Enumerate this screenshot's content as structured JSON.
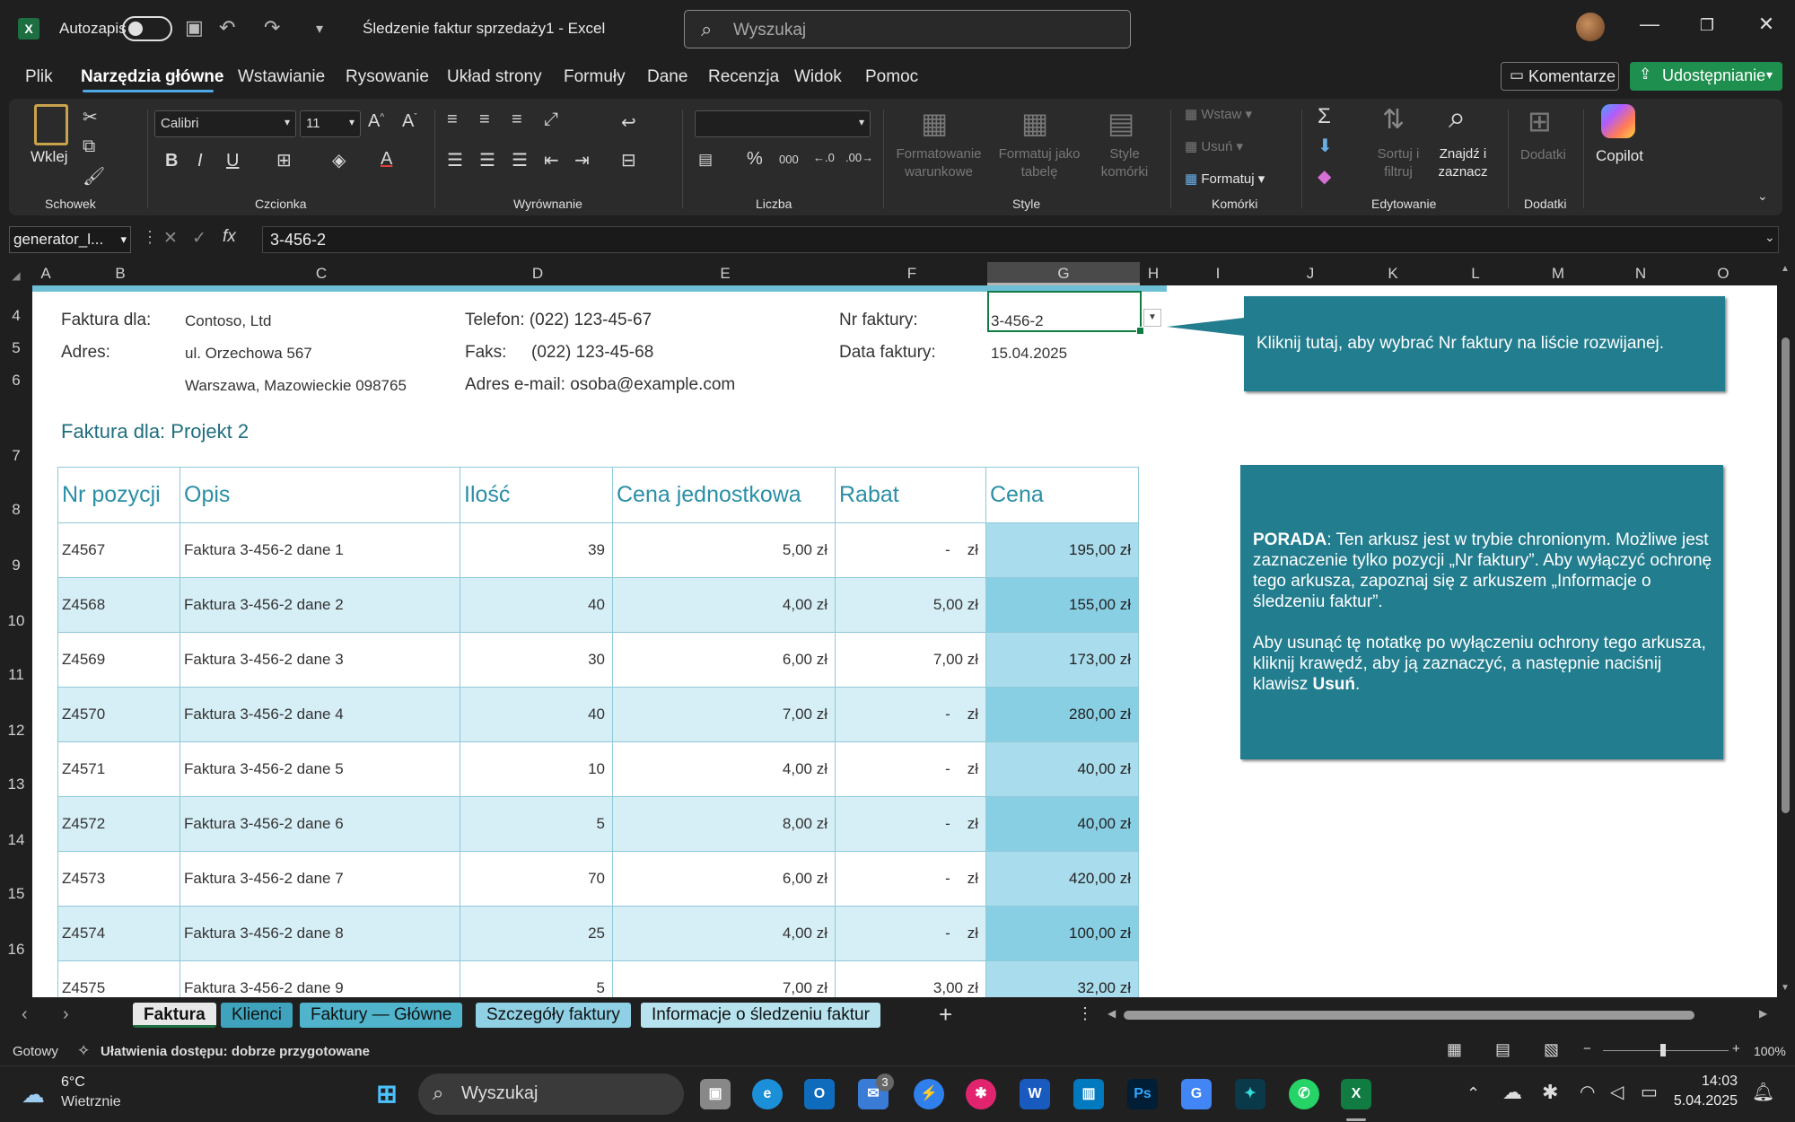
{
  "window": {
    "autosave_label": "Autozapis",
    "title": "Śledzenie faktur sprzedaży1  -  Excel",
    "search_placeholder": "Wyszukaj"
  },
  "menu": {
    "items": [
      "Plik",
      "Narzędzia główne",
      "Wstawianie",
      "Rysowanie",
      "Układ strony",
      "Formuły",
      "Dane",
      "Recenzja",
      "Widok",
      "Pomoc"
    ],
    "comments_label": "Komentarze",
    "share_label": "Udostępnianie"
  },
  "ribbon": {
    "paste": "Wklej",
    "clipboard": "Schowek",
    "font_name": "Calibri",
    "font_size": "11",
    "font_group": "Czcionka",
    "alignment_group": "Wyrównanie",
    "number_group": "Liczba",
    "cond_format": "Formatowanie warunkowe",
    "format_table": "Formatuj jako tabelę",
    "cell_styles": "Style komórki",
    "styles_group": "Style",
    "insert": "Wstaw",
    "delete": "Usuń",
    "format": "Formatuj",
    "cells_group": "Komórki",
    "sort_filter": "Sortuj i filtruj",
    "find_select": "Znajdź i zaznacz",
    "editing_group": "Edytowanie",
    "addins": "Dodatki",
    "addins_group": "Dodatki",
    "copilot": "Copilot"
  },
  "formula_bar": {
    "name_box": "generator_l...",
    "content": "3-456-2"
  },
  "columns": [
    "A",
    "B",
    "C",
    "D",
    "E",
    "F",
    "G",
    "H",
    "I",
    "J",
    "K",
    "L",
    "M",
    "N",
    "O"
  ],
  "selected_column": "G",
  "rows": [
    "4",
    "5",
    "6",
    "7",
    "8",
    "9",
    "10",
    "11",
    "12",
    "13",
    "14",
    "15",
    "16"
  ],
  "header": {
    "bill_to_label": "Faktura dla:",
    "bill_to_value": "Contoso, Ltd",
    "address_label": "Adres:",
    "address_line1": "ul. Orzechowa 567",
    "address_line2": "Warszawa, Mazowieckie 098765",
    "phone": "Telefon: (022) 123-45-67",
    "fax_label": "Faks:",
    "fax_value": "(022) 123-45-68",
    "email": "Adres e-mail: osoba@example.com",
    "invoice_no_label": "Nr faktury:",
    "invoice_no_value": "3-456-2",
    "invoice_date_label": "Data faktury:",
    "invoice_date_value": "15.04.2025",
    "project": "Faktura dla: Projekt 2"
  },
  "callout": "Kliknij tutaj, aby wybrać Nr faktury na liście rozwijanej.",
  "tip": {
    "bold1": "PORADA",
    "text1": ": Ten arkusz jest w trybie chronionym. Możliwe jest zaznaczenie tylko pozycji „Nr faktury”. Aby wyłączyć ochronę tego arkusza, zapoznaj się z arkuszem „Informacje o śledzeniu faktur”.",
    "text2": "Aby usunąć tę notatkę po wyłączeniu ochrony tego arkusza, kliknij krawędź, aby ją zaznaczyć, a następnie naciśnij klawisz ",
    "bold2": "Usuń",
    "end": "."
  },
  "table": {
    "headers": [
      "Nr pozycji",
      "Opis",
      "Ilość",
      "Cena jednostkowa",
      "Rabat",
      "Cena"
    ],
    "rows": [
      [
        "Z4567",
        "Faktura 3-456-2 dane 1",
        "39",
        "5,00 zł",
        "-    zł",
        "195,00 zł"
      ],
      [
        "Z4568",
        "Faktura 3-456-2 dane 2",
        "40",
        "4,00 zł",
        "5,00 zł",
        "155,00 zł"
      ],
      [
        "Z4569",
        "Faktura 3-456-2 dane 3",
        "30",
        "6,00 zł",
        "7,00 zł",
        "173,00 zł"
      ],
      [
        "Z4570",
        "Faktura 3-456-2 dane 4",
        "40",
        "7,00 zł",
        "-    zł",
        "280,00 zł"
      ],
      [
        "Z4571",
        "Faktura 3-456-2 dane 5",
        "10",
        "4,00 zł",
        "-    zł",
        "40,00 zł"
      ],
      [
        "Z4572",
        "Faktura 3-456-2 dane 6",
        "5",
        "8,00 zł",
        "-    zł",
        "40,00 zł"
      ],
      [
        "Z4573",
        "Faktura 3-456-2 dane 7",
        "70",
        "6,00 zł",
        "-    zł",
        "420,00 zł"
      ],
      [
        "Z4574",
        "Faktura 3-456-2 dane 8",
        "25",
        "4,00 zł",
        "-    zł",
        "100,00 zł"
      ],
      [
        "Z4575",
        "Faktura 3-456-2 dane 9",
        "5",
        "7,00 zł",
        "3,00 zł",
        "32,00 zł"
      ]
    ]
  },
  "sheet_tabs": [
    {
      "label": "Faktura",
      "color": "#e8e8e8"
    },
    {
      "label": "Klienci",
      "color": "#3fa3bd"
    },
    {
      "label": "Faktury — Główne",
      "color": "#4fb4cc"
    },
    {
      "label": "Szczegóły faktury",
      "color": "#8fd0e4"
    },
    {
      "label": "Informacje o śledzeniu faktur",
      "color": "#b7e3ef"
    }
  ],
  "status": {
    "ready": "Gotowy",
    "accessibility": "Ułatwienia dostępu: dobrze przygotowane",
    "zoom": "100%"
  },
  "taskbar": {
    "weather_temp": "6°C",
    "weather_desc": "Wietrznie",
    "search": "Wyszukaj",
    "badge": "3",
    "time": "14:03",
    "date": "5.04.2025"
  }
}
